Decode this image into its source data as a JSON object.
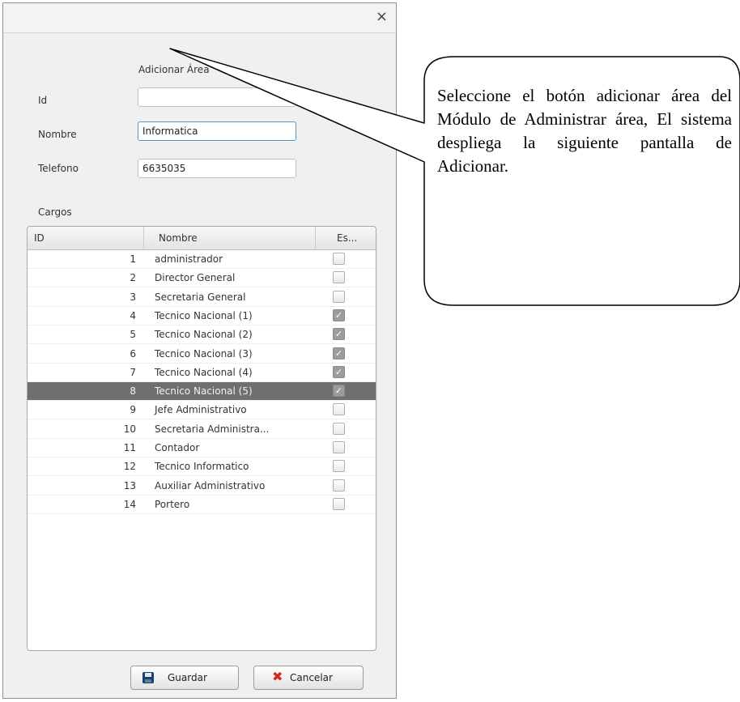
{
  "dialog": {
    "close_glyph": "×",
    "heading": "Adicionar Área",
    "fields": {
      "id": {
        "label": "Id",
        "value": ""
      },
      "nombre": {
        "label": "Nombre",
        "value": "Informatica"
      },
      "telefono": {
        "label": "Telefono",
        "value": "6635035"
      }
    },
    "cargos_label": "Cargos",
    "table": {
      "headers": [
        "ID",
        "Nombre",
        "Es..."
      ],
      "rows": [
        {
          "id": "1",
          "nombre": "administrador",
          "checked": false
        },
        {
          "id": "2",
          "nombre": "Director General",
          "checked": false
        },
        {
          "id": "3",
          "nombre": "Secretaria General",
          "checked": false
        },
        {
          "id": "4",
          "nombre": "Tecnico Nacional (1)",
          "checked": true
        },
        {
          "id": "5",
          "nombre": "Tecnico Nacional (2)",
          "checked": true
        },
        {
          "id": "6",
          "nombre": "Tecnico Nacional (3)",
          "checked": true
        },
        {
          "id": "7",
          "nombre": "Tecnico Nacional (4)",
          "checked": true
        },
        {
          "id": "8",
          "nombre": "Tecnico Nacional (5)",
          "checked": true,
          "selected": true
        },
        {
          "id": "9",
          "nombre": "Jefe Administrativo",
          "checked": false
        },
        {
          "id": "10",
          "nombre": "Secretaria Administra...",
          "checked": false
        },
        {
          "id": "11",
          "nombre": "Contador",
          "checked": false
        },
        {
          "id": "12",
          "nombre": "Tecnico Informatico",
          "checked": false
        },
        {
          "id": "13",
          "nombre": "Auxiliar Administrativo",
          "checked": false
        },
        {
          "id": "14",
          "nombre": "Portero",
          "checked": false
        }
      ]
    },
    "buttons": {
      "save_label": "Guardar",
      "cancel_label": "Cancelar"
    }
  },
  "callout": {
    "text": "Seleccione el botón adicionar área del Módulo de Administrar área, El sistema despliega la siguiente pantalla de Adicionar."
  }
}
